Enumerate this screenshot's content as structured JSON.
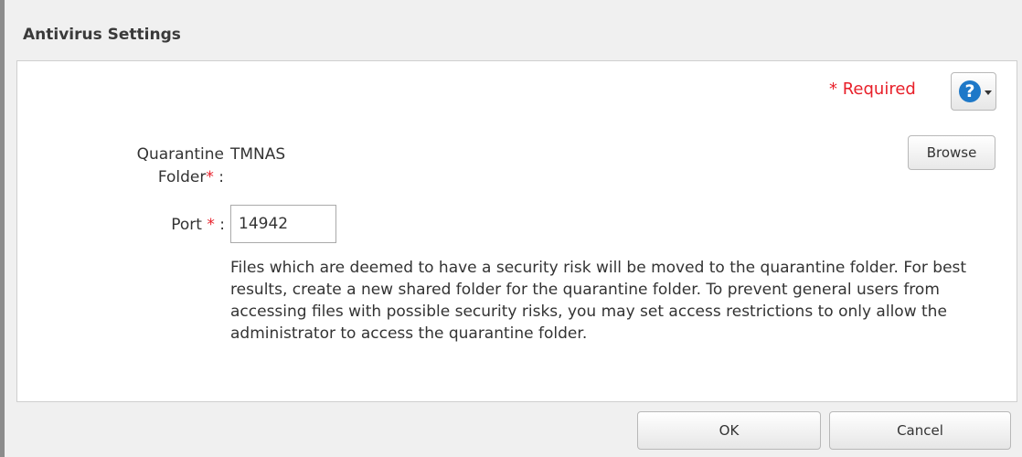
{
  "dialog": {
    "title": "Antivirus Settings"
  },
  "header": {
    "required_label": "*  Required",
    "help_icon": "question-circle-icon"
  },
  "form": {
    "quarantine_label_line1": "Quarantine",
    "quarantine_label_line2": "Folder",
    "quarantine_value": "TMNAS",
    "browse_label": "Browse",
    "port_label": "Port",
    "port_value": "14942",
    "star": "*",
    "colon": " :"
  },
  "description": "Files which are deemed to have a security risk will be moved to the quarantine folder. For best results, create a new shared folder for the quarantine folder. To prevent general users from accessing files with possible security risks, you may set access restrictions to only allow the administrator to access the quarantine folder.",
  "footer": {
    "ok_label": "OK",
    "cancel_label": "Cancel"
  },
  "colors": {
    "accent": "#1e78c8",
    "required": "#e8202a"
  }
}
